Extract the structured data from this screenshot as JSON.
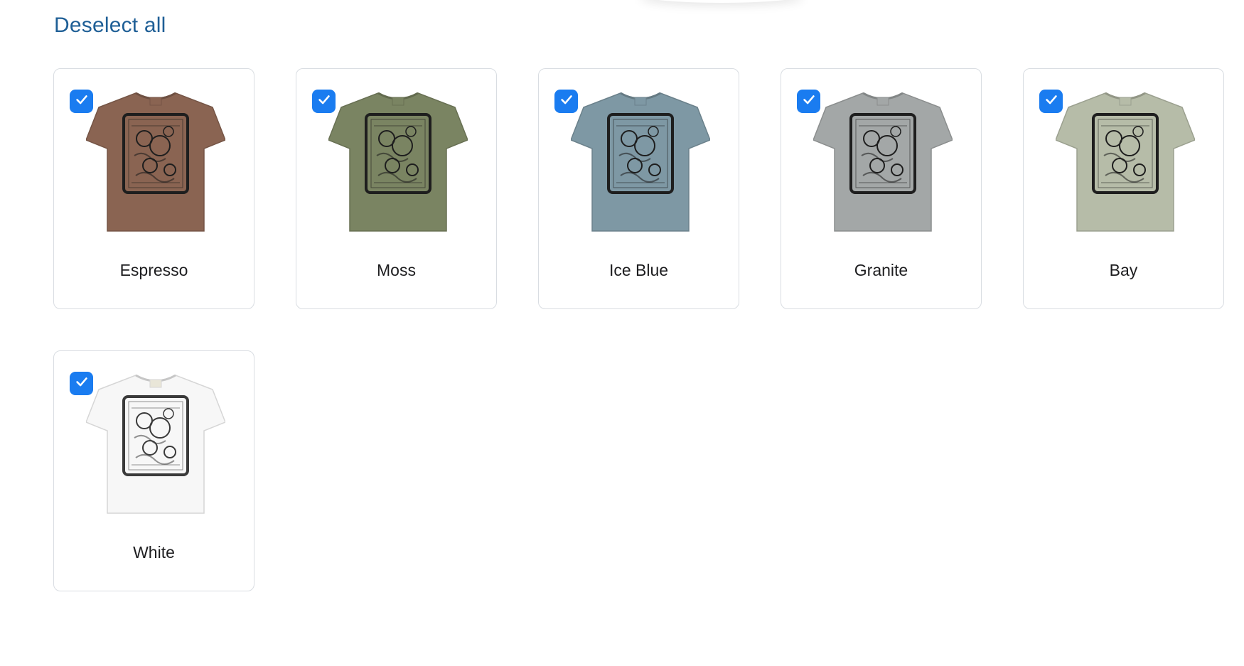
{
  "header": {
    "deselect_all_label": "Deselect all"
  },
  "colors": {
    "link": "#1f5f96",
    "checkbox": "#1a7cf0",
    "card_border": "#d9dde2"
  },
  "variants": [
    {
      "label": "Espresso",
      "shirt_color": "#8a6452",
      "checked": true
    },
    {
      "label": "Moss",
      "shirt_color": "#7a8462",
      "checked": true
    },
    {
      "label": "Ice Blue",
      "shirt_color": "#7e98a4",
      "checked": true
    },
    {
      "label": "Granite",
      "shirt_color": "#a3a7a7",
      "checked": true
    },
    {
      "label": "Bay",
      "shirt_color": "#b6bca8",
      "checked": true
    },
    {
      "label": "White",
      "shirt_color": "#f7f7f7",
      "checked": true
    }
  ]
}
